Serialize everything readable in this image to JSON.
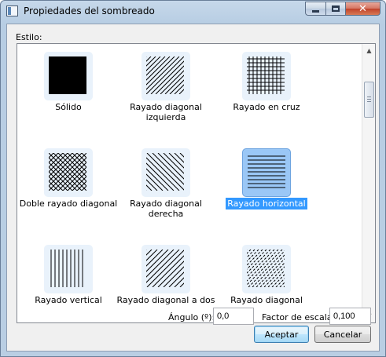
{
  "window": {
    "title": "Propiedades del sombreado"
  },
  "estilo_label": "Estilo:",
  "styles": [
    {
      "label": "Sólido",
      "pattern": "solid",
      "selected": false
    },
    {
      "label": "Rayado diagonal izquierda",
      "pattern": "diag-left",
      "selected": false
    },
    {
      "label": "Rayado en cruz",
      "pattern": "cross",
      "selected": false
    },
    {
      "label": "Doble rayado diagonal",
      "pattern": "double-diag",
      "selected": false
    },
    {
      "label": "Rayado diagonal derecha",
      "pattern": "diag-right",
      "selected": false
    },
    {
      "label": "Rayado horizontal",
      "pattern": "horizontal",
      "selected": true
    },
    {
      "label": "Rayado vertical",
      "pattern": "vertical",
      "selected": false
    },
    {
      "label": "Rayado diagonal a dos",
      "pattern": "diag-two",
      "selected": false
    },
    {
      "label": "Rayado diagonal",
      "pattern": "diag-dashed",
      "selected": false
    }
  ],
  "angle": {
    "label": "Ángulo (º):",
    "value": "0,0"
  },
  "scale": {
    "label": "Factor de escala:",
    "value": "0,100"
  },
  "buttons": {
    "ok": "Aceptar",
    "cancel": "Cancelar"
  },
  "colors": {
    "selection": "#3399ff",
    "thumb_bg": "#e9f2fb",
    "selected_thumb_bg": "#9ac7f6"
  }
}
